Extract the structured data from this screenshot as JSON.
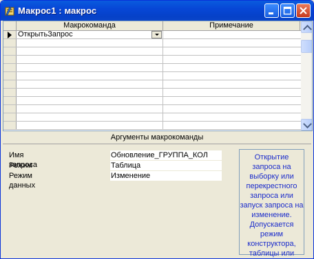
{
  "window": {
    "title": "Макрос1 : макрос"
  },
  "grid": {
    "columns": [
      "Макрокоманда",
      "Примечание"
    ],
    "rows": [
      {
        "action": "ОткрытьЗапрос",
        "comment": "",
        "current": true
      },
      {
        "action": "",
        "comment": ""
      },
      {
        "action": "",
        "comment": ""
      },
      {
        "action": "",
        "comment": ""
      },
      {
        "action": "",
        "comment": ""
      },
      {
        "action": "",
        "comment": ""
      },
      {
        "action": "",
        "comment": ""
      },
      {
        "action": "",
        "comment": ""
      },
      {
        "action": "",
        "comment": ""
      },
      {
        "action": "",
        "comment": ""
      },
      {
        "action": "",
        "comment": ""
      },
      {
        "action": "",
        "comment": ""
      }
    ]
  },
  "args": {
    "title": "Аргументы макрокоманды",
    "fields": [
      {
        "label": "Имя запроса",
        "value": "Обновление_ГРУППА_КОЛ"
      },
      {
        "label": "Режим",
        "value": "Таблица"
      },
      {
        "label": "Режим данных",
        "value": "Изменение"
      }
    ],
    "hint": "Открытие запроса на выборку или перекрестного запроса или запуск запроса на изменение. Допускается режим конструктора, таблицы или"
  },
  "colors": {
    "titlebar": "#0747d6",
    "hint_text": "#1a2bcb"
  },
  "icons": [
    "macro-icon",
    "minimize-icon",
    "maximize-icon",
    "close-icon",
    "current-row-arrow-icon",
    "dropdown-arrow-icon"
  ]
}
